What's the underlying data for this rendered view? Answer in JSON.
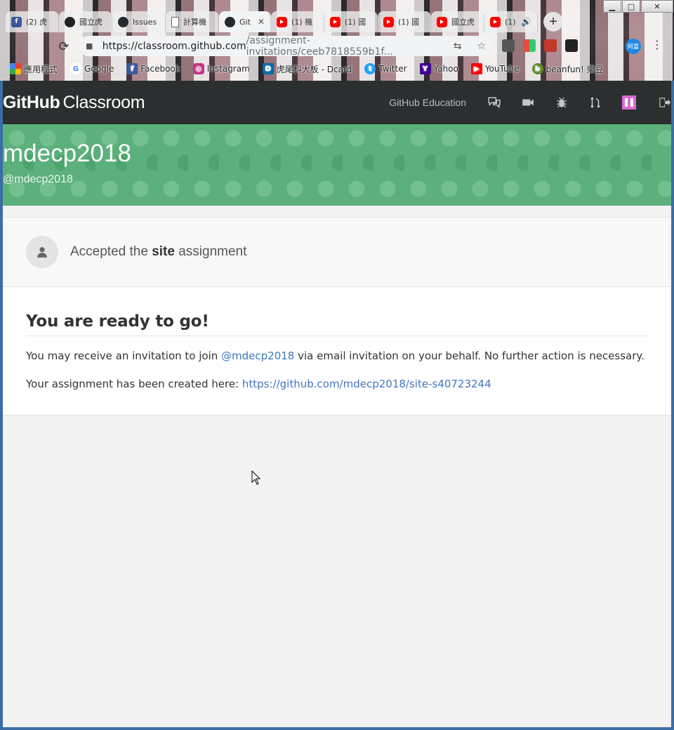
{
  "window": {
    "minimize_glyph": "▁",
    "maximize_glyph": "□",
    "close_glyph": "✕"
  },
  "tabs": [
    {
      "label": "(2) 虎",
      "favicon": "facebook-icon",
      "active": false
    },
    {
      "label": "國立虎",
      "favicon": "cat-icon",
      "active": false
    },
    {
      "label": "Issues",
      "favicon": "github-icon",
      "active": false
    },
    {
      "label": "計算機",
      "favicon": "document-icon",
      "active": false
    },
    {
      "label": "Git",
      "favicon": "github-icon",
      "active": true
    },
    {
      "label": "(1) 機",
      "favicon": "youtube-icon",
      "active": false
    },
    {
      "label": "(1) 國",
      "favicon": "youtube-icon",
      "active": false
    },
    {
      "label": "(1) 國",
      "favicon": "youtube-icon",
      "active": false
    },
    {
      "label": "國立虎",
      "favicon": "youtube-icon",
      "active": false
    },
    {
      "label": "(1)",
      "favicon": "youtube-icon",
      "active": false
    }
  ],
  "tab_close_glyph": "✕",
  "new_tab_glyph": "+",
  "address_bar": {
    "host": "https://classroom.github.com",
    "path": "/assignment-invitations/ceeb7818559b1f...",
    "reload_glyph": "⟳",
    "lock_glyph": "🔒",
    "translate_glyph": "⇆",
    "star_glyph": "☆"
  },
  "profile_label": "阿嘉",
  "menu_glyph": "⋮",
  "bookmarks": [
    {
      "label": "應用程式",
      "icon": "apps-grid-icon",
      "color": "#e94235"
    },
    {
      "label": "Google",
      "icon": "google-icon",
      "color": "#4285f4"
    },
    {
      "label": "Facebook",
      "icon": "facebook-icon",
      "color": "#3b5998"
    },
    {
      "label": "Instagram",
      "icon": "instagram-icon",
      "color": "#c13584"
    },
    {
      "label": "虎尾科大板 - Dcard",
      "icon": "dcard-icon",
      "color": "#006aa6"
    },
    {
      "label": "Twitter",
      "icon": "twitter-icon",
      "color": "#1da1f2"
    },
    {
      "label": "Yahoo",
      "icon": "yahoo-icon",
      "color": "#400090"
    },
    {
      "label": "YouTube",
      "icon": "youtube-icon",
      "color": "#ff0000"
    },
    {
      "label": "beanfun! 樂豆",
      "icon": "beanfun-icon",
      "color": "#5a8a2a"
    }
  ],
  "header": {
    "logo_bold": "GitHub",
    "logo_light": "Classroom",
    "education_link": "GitHub Education",
    "nav_icons": [
      "comment-discussion-icon",
      "video-icon",
      "bug-icon",
      "git-pull-request-icon",
      "user-avatar-icon",
      "sign-out-icon"
    ]
  },
  "hero": {
    "org_name": "mdecp2018",
    "org_handle": "@mdecp2018",
    "bg_color": "#5cb07b"
  },
  "accepted": {
    "prefix": "Accepted the ",
    "assignment_name": "site",
    "suffix": " assignment"
  },
  "ready": {
    "title": "You are ready to go!",
    "line1_prefix": "You may receive an invitation to join ",
    "line1_link": "@mdecp2018",
    "line1_suffix": " via email invitation on your behalf. No further action is necessary.",
    "line2_prefix": "Your assignment has been created here: ",
    "line2_link": "https://github.com/mdecp2018/site-s40723244"
  },
  "colors": {
    "header_bg": "#2b2f30",
    "link": "#4078c0",
    "page_bg": "#f3f3f3"
  }
}
